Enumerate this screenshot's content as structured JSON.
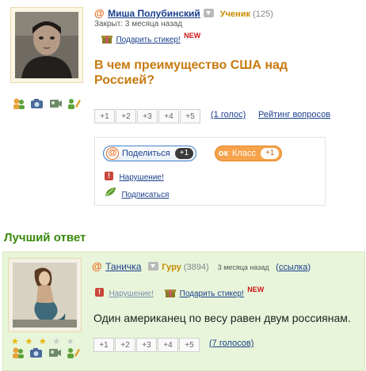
{
  "question_block": {
    "user_name": "Миша Полубинский",
    "rank_label": "Ученик",
    "rank_score": "(125)",
    "status": "Закрыт: 3 месяца назад",
    "gift_label": "Подарить стикер!",
    "new_badge": "NEW",
    "question_text": "В чем преимущество США над Россией?",
    "votes": [
      "+1",
      "+2",
      "+3",
      "+4",
      "+5"
    ],
    "votes_count": "(1 голос)",
    "rating_link": "Рейтинг вопросов",
    "share_label": "Поделиться",
    "share_count": "+1",
    "class_label": "Класс",
    "class_count": "+1",
    "violation_label": "Нарушение!",
    "subscribe_label": "Подписаться"
  },
  "best_answer": {
    "title": "Лучший ответ",
    "user_name": "Таничка",
    "rank_label": "Гуру",
    "rank_score": "(3894)",
    "time": "3 месяца назад",
    "link_label": "ссылка",
    "violation_label": "Нарушение!",
    "gift_label": "Подарить стикер!",
    "new_badge": "NEW",
    "answer_text": "Один американец по весу равен двум россиянам.",
    "votes": [
      "+1",
      "+2",
      "+3",
      "+4",
      "+5"
    ],
    "votes_count": "(7 голосов)",
    "stars_filled": 3,
    "stars_total": 5
  },
  "colors": {
    "accent_orange": "#c87a10",
    "link_blue": "#1a3f8c",
    "best_green": "#3a8a0c",
    "best_bg": "#e8f5da"
  }
}
